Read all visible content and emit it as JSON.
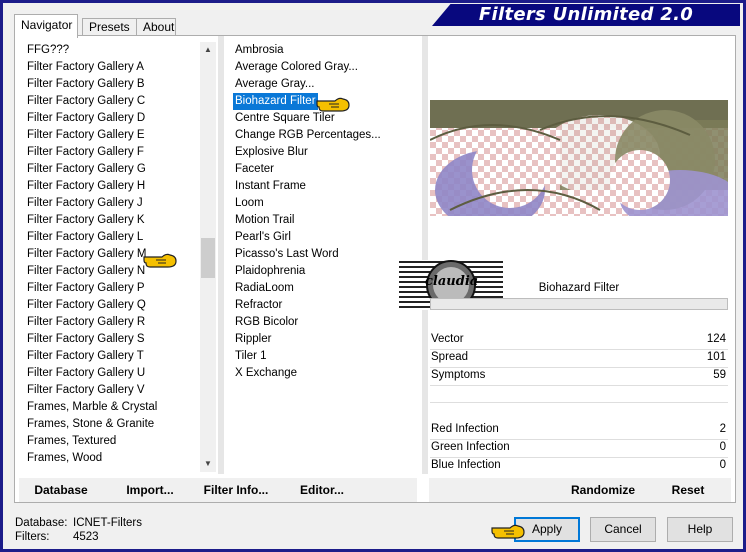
{
  "window": {
    "brand": "Filters Unlimited 2.0"
  },
  "tabs": [
    {
      "label": "Navigator",
      "active": true
    },
    {
      "label": "Presets",
      "active": false
    },
    {
      "label": "About",
      "active": false
    }
  ],
  "categories": [
    "FFG???",
    "Filter Factory Gallery A",
    "Filter Factory Gallery B",
    "Filter Factory Gallery C",
    "Filter Factory Gallery D",
    "Filter Factory Gallery E",
    "Filter Factory Gallery F",
    "Filter Factory Gallery G",
    "Filter Factory Gallery H",
    "Filter Factory Gallery J",
    "Filter Factory Gallery K",
    "Filter Factory Gallery L",
    "Filter Factory Gallery M",
    "Filter Factory Gallery N",
    "Filter Factory Gallery P",
    "Filter Factory Gallery Q",
    "Filter Factory Gallery R",
    "Filter Factory Gallery S",
    "Filter Factory Gallery T",
    "Filter Factory Gallery U",
    "Filter Factory Gallery V",
    "Frames, Marble & Crystal",
    "Frames, Stone & Granite",
    "Frames, Textured",
    "Frames, Wood"
  ],
  "filters": [
    "Ambrosia",
    "Average Colored Gray...",
    "Average Gray...",
    "Biohazard Filter",
    "Centre Square Tiler",
    "Change RGB Percentages...",
    "Explosive Blur",
    "Faceter",
    "Instant Frame",
    "Loom",
    "Motion Trail",
    "Pearl's Girl",
    "Picasso's Last Word",
    "Plaidophrenia",
    "RadiaLoom",
    "Refractor",
    "RGB Bicolor",
    "Rippler",
    "Tiler 1",
    "X Exchange"
  ],
  "selected_filter": "Biohazard Filter",
  "filter_title": "Biohazard Filter",
  "watermark": "claudia",
  "params": [
    {
      "label": "Vector",
      "value": "124"
    },
    {
      "label": "Spread",
      "value": "101"
    },
    {
      "label": "Symptoms",
      "value": "59"
    },
    {
      "label": "Red Infection",
      "value": "2"
    },
    {
      "label": "Green Infection",
      "value": "0"
    },
    {
      "label": "Blue Infection",
      "value": "0"
    }
  ],
  "toolbar": {
    "database": "Database",
    "import": "Import...",
    "filter_info": "Filter Info...",
    "editor": "Editor...",
    "randomize": "Randomize",
    "reset": "Reset"
  },
  "status": {
    "database_label": "Database:",
    "database_value": "ICNET-Filters",
    "filters_label": "Filters:",
    "filters_value": "4523"
  },
  "buttons": {
    "apply": "Apply",
    "cancel": "Cancel",
    "help": "Help"
  },
  "colors": {
    "accent": "#0a78d7",
    "brand_bg": "#08087e",
    "hand": "#f5c000"
  }
}
